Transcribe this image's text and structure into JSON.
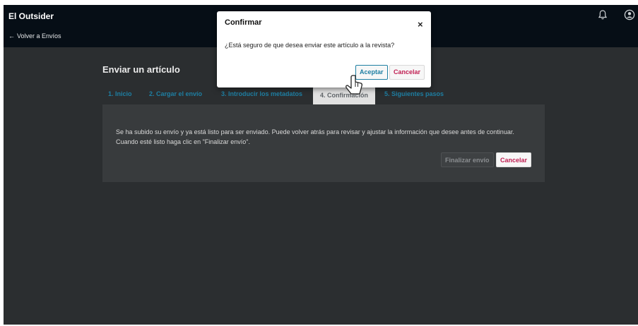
{
  "header": {
    "site_title": "El Outsider",
    "back_link": "Volver a Envíos",
    "back_arrow": "←"
  },
  "page": {
    "heading": "Enviar un artículo",
    "tabs": [
      {
        "label": "1. Inicio"
      },
      {
        "label": "2. Cargar el envío"
      },
      {
        "label": "3. Introducir los metadatos"
      },
      {
        "label": "4. Confirmación"
      },
      {
        "label": "5. Siguientes pasos"
      }
    ],
    "active_tab": "4. Confirmación",
    "message_line1": "Se ha subido su envío y ya está listo para ser enviado. Puede volver atrás para revisar y ajustar la información que desee antes de continuar.",
    "message_line2": "Cuando esté listo haga clic en \"Finalizar envío\".",
    "finalize_label": "Finalizar envío",
    "cancel_label": "Cancelar"
  },
  "modal": {
    "title": "Confirmar",
    "close_glyph": "×",
    "message": "¿Está seguro de que desea enviar este artículo a la revista?",
    "accept_label": "Aceptar",
    "cancel_label": "Cancelar"
  },
  "icons": {
    "bell": "bell-icon",
    "user": "user-icon",
    "cursor": "hand-cursor-icon"
  },
  "colors": {
    "header_bg": "#060e16",
    "overlay_bg": "#2b2e30",
    "link_blue": "#1e7fa3",
    "cancel_red": "#c01f52"
  }
}
